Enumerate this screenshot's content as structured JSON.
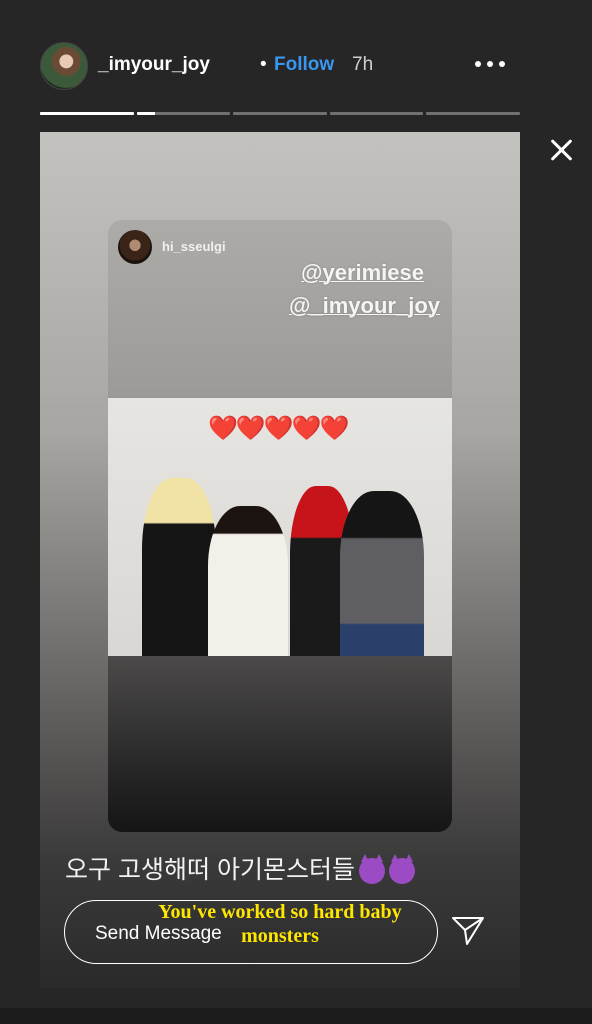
{
  "header": {
    "username": "_imyour_joy",
    "separator": "•",
    "follow_label": "Follow",
    "time": "7h"
  },
  "progress": {
    "segments": [
      1,
      0.2,
      0,
      0,
      0
    ]
  },
  "icons": {
    "more": "more-dots-icon",
    "close": "close-icon",
    "send": "send-icon"
  },
  "story": {
    "card": {
      "username": "hi_sseulgi",
      "mention_1": "@yerimiese",
      "mention_2": "@_imyour_joy",
      "hearts": "❤️❤️❤️❤️❤️"
    },
    "caption": "오구 고생해떠 아기몬스터들"
  },
  "message": {
    "placeholder": "Send Message"
  },
  "overlay_text": "You've worked so hard baby monsters",
  "colors": {
    "follow": "#3897f0",
    "overlay": "#ffe600"
  }
}
